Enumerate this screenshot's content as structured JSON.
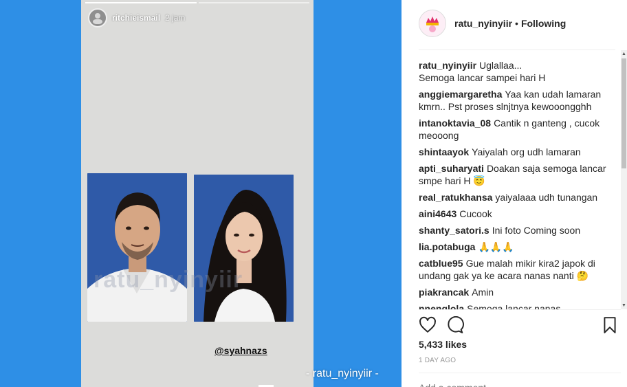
{
  "story": {
    "username": "ritchieismail",
    "time": "2 jam",
    "tag": "@syahnazs",
    "watermark_center": "ratu_nyinyiir",
    "watermark_bottom": "- ratu_nyinyiir -"
  },
  "post": {
    "username": "ratu_nyinyiir",
    "separator": "•",
    "follow_status": "Following"
  },
  "comments": [
    {
      "user": "ratu_nyinyiir",
      "text": "Uglallaa...\nSemoga lancar sampei hari H"
    },
    {
      "user": "anggiemargaretha",
      "text": "Yaa kan udah lamaran kmrn.. Pst proses slnjtnya kewooongghh"
    },
    {
      "user": "intanoktavia_08",
      "text": "Cantik n ganteng , cucok meooong"
    },
    {
      "user": "shintaayok",
      "text": "Yaiyalah org udh lamaran"
    },
    {
      "user": "apti_suharyati",
      "text": "Doakan saja semoga lancar smpe hari H 😇"
    },
    {
      "user": "real_ratukhansa",
      "text": "yaiyalaaa udh tunangan"
    },
    {
      "user": "aini4643",
      "text": "Cucook"
    },
    {
      "user": "shanty_satori.s",
      "text": "Ini foto Coming soon"
    },
    {
      "user": "lia.potabuga",
      "text": "🙏🙏🙏"
    },
    {
      "user": "catblue95",
      "text": "Gue malah mikir kira2 japok di undang gak ya ke acara nanas nanti 🤔"
    },
    {
      "user": "piakrancak",
      "text": "Amin"
    },
    {
      "user": "nnenglola",
      "text": "Semoga lancar nanas"
    }
  ],
  "actions": {
    "like_icon": "heart-icon",
    "comment_icon": "comment-icon",
    "save_icon": "bookmark-icon"
  },
  "likes": "5,433 likes",
  "time_ago": "1 DAY AGO",
  "add_comment_placeholder": "Add a comment...",
  "colors": {
    "background_blue": "#2e8fe6",
    "text": "#262626",
    "muted": "#999999"
  }
}
